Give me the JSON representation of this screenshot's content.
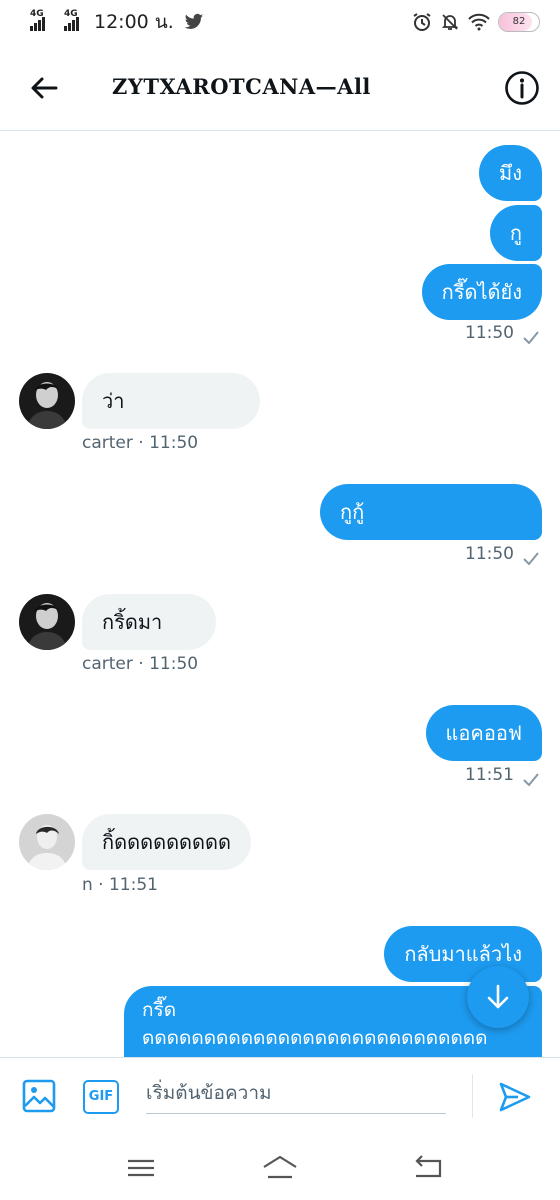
{
  "status_bar": {
    "network1": "4G",
    "network2": "4G",
    "time": "12:00 น.",
    "battery": "82",
    "battery_level": 0.82
  },
  "header": {
    "title": "ZYTXAROTCANA—All"
  },
  "messages": [
    {
      "type": "sent",
      "text": "มึง"
    },
    {
      "type": "sent",
      "text": "กู"
    },
    {
      "type": "sent",
      "text": "กรี๊ดได้ยัง",
      "time": "11:50"
    },
    {
      "type": "received",
      "text": "ว่า",
      "meta": "carter · 11:50"
    },
    {
      "type": "sent",
      "text": "กูกู้",
      "time": "11:50"
    },
    {
      "type": "received",
      "text": "กริ้ดมา",
      "meta": "carter · 11:50"
    },
    {
      "type": "sent",
      "text": "แอคออฟ",
      "time": "11:51"
    },
    {
      "type": "received",
      "text": "กิ้ดดดดดดดดด",
      "meta": "n · 11:51"
    },
    {
      "type": "sent",
      "text": "กลับมาแล้วไง"
    },
    {
      "type": "sent",
      "text_line1": "กรี๊ด",
      "text_line2": "ดดดดดดดดดดดดดดดดดดดดดดดดดดดด"
    }
  ],
  "composer": {
    "placeholder": "เริ่มต้นข้อความ",
    "gif_label": "GIF"
  },
  "icons": {
    "back": "arrow-left-icon",
    "info": "info-circle-icon",
    "media": "image-icon",
    "send": "send-icon",
    "scroll_down": "arrow-down-icon",
    "nav_menu": "menu-icon",
    "nav_home": "home-icon",
    "nav_back": "back-icon"
  },
  "colors": {
    "accent": "#1d9bf0",
    "received_bubble": "#eff3f4",
    "meta_text": "#536471"
  }
}
